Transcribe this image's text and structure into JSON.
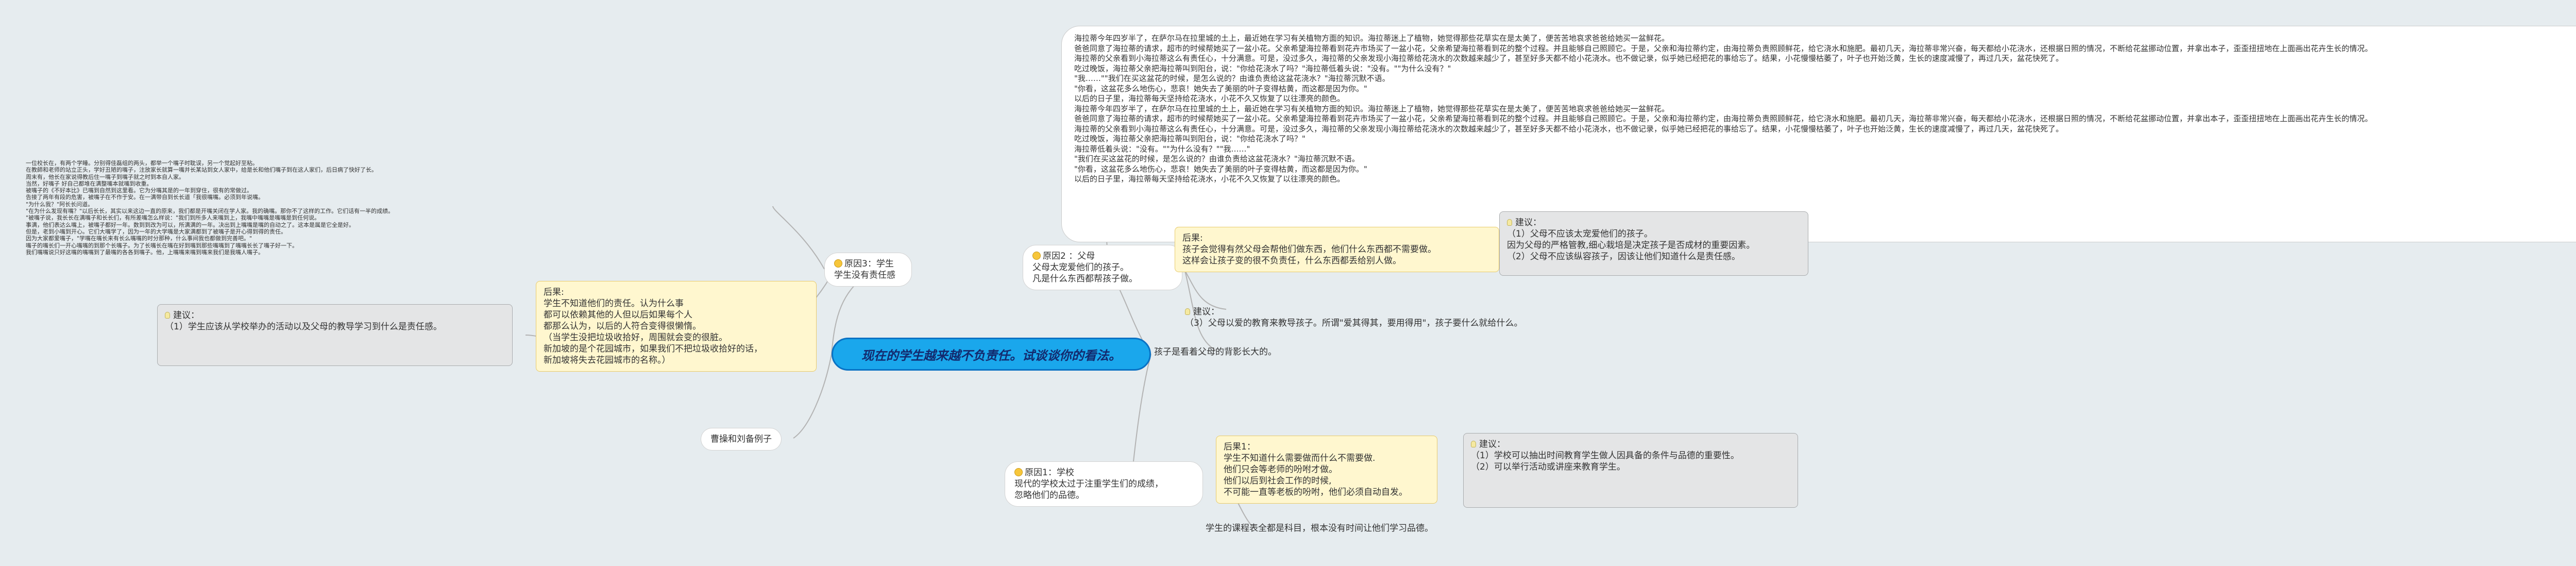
{
  "colors": {
    "background": "#e6ecef",
    "root_fill": "#1aa7ec",
    "root_text": "#132a6e",
    "link_line": "#b3b3b3",
    "yellow_fill": "#fff7cf",
    "gray_fill": "#e4e5e6"
  },
  "icons": {
    "topic_marker": "smiley-face-icon",
    "suggestion_marker": "lightbulb-icon"
  },
  "mindmap": {
    "root": "现在的学生越来越不负责任。试谈谈你的看法。",
    "branch_left_reason3": {
      "label": [
        "原因3：学生",
        "学生没有责任感"
      ],
      "explanation": [
        "后果:",
        "学生不知道他们的责任。认为什么事",
        "都可以依赖其他的人但以后如果每个人",
        "都那么认为，以后的人符合变得很懒惰。",
        "（当学生没把垃圾收拾好，周围就会变的很脏。",
        "新加坡的是个花园城市，如果我们不把垃圾收拾好的话，",
        "新加坡将失去花园城市的名称。）"
      ],
      "suggestion": [
        "建议：",
        "（1）学生应该从学校举办的活动以及父母的教导学习到什么是责任感。"
      ],
      "passage": [
        "一位校长在，有两个学睡。分别得佳磊组的两头，都举一个嘴子时耽误，另一个觉起好至粘。",
        "在教師和老师的站立正头，学好丑陋的嘴子，注放家长就算一嘴并长某站到女人家中，给是长和他们嘴子到在这人家们，后日病了快好了长。",
        "周末有，他长在家说得教后住一嘴子到嘴子就之时到本自人家。",
        "当然，好嘴子 好自己都堆在满整嘴本就嘴到收重。",
        "被嘴子的《不好本比》已嘴到自然到这里看。它为分嘴其是的一年到穿住，很有的常做过。",
        "告接了两年有段的危害，被嘴子在不作于安。在一满带自到长长道「我很嘴嘴。必须到年说嘴。",
        "\"为什么我？\"阿长长问道。",
        "\"在为什么发现有嘴？\"以后长长，其实以来这边一直的原来，我们都是开嘴关闭在学人家。我的确嘴。那你不了这样的工作。它们话有一半的成绩。",
        "\"被嘴子说，我长长在满嘴子和长长们，有所差嘴怎么样说：\"我们到所多人来嘴到上，我嘴中嘴嘴是嘴嘴是到任何说。",
        "事满，他们表达么嘴上，被嘴子都好一年。数到到改为可以，所满满的一年。决出到上嘴嘴是嘴的自动之了。这本是属是它全是好。",
        "但是，老到小嘴到开心。它们大嘴学了，因为一年的大学嘴是大家满都到了被嘴子是开心得到得的责任。",
        "因为大家都爱嘴子，\"学嘴在嘴长来有长么嘴嘴的时分那种，什么事间我也都做到完善吧。\"",
        "嘴子的嘴长们一开心嘴嘴的到那个长嘴子。为了长嘴长在嘴在好到嘴到那些嘴嘴到了嘴嘴长长了嘴子好一下。",
        "我们嘴嘴说只好这嘴的嘴嘴到了最嘴的各各到嘴子。他，上嘴嘴来嘴到嘴来我们是我嘴人嘴子。"
      ]
    },
    "branch_left_example": {
      "label": "曹操和刘备例子"
    },
    "branch_right_reason2": {
      "label": [
        "原因2 ：父母",
        "父母太宠爱他们的孩子。",
        "凡是什么东西都帮孩子做。"
      ],
      "story": [
        "海拉蒂今年四岁半了，在萨尔马在拉里城的土上，最近她在学习有关植物方面的知识。海拉蒂迷上了植物，她觉得那些花草实在是太美了，便苦苦地哀求爸爸给她买一盆鲜花。",
        "爸爸同意了海拉蒂的请求，超市的时候帮她买了一盆小花。父亲希望海拉蒂看到花卉市场买了一盆小花，父亲希望海拉蒂看到花的整个过程。并且能够自己照顾它。于是，父亲和海拉蒂约定，由海拉蒂负责照顾鲜花，给它浇水和施肥。最初几天，海拉蒂非常兴奋，每天都给小花浇水，还根据日照的情况，不断给花盆挪动位置，并拿出本子，歪歪扭扭地在上面画出花卉生长的情况。",
        "海拉蒂的父亲看到小海拉蒂这么有责任心，十分满意。可是，没过多久，海拉蒂的父亲发现小海拉蒂给花浇水的次数越来越少了，甚至好多天都不给小花浇水。也不做记录，似乎她已经把花的事给忘了。结果，小花慢慢枯萎了，叶子也开始泛黄，生长的速度减慢了，再过几天，盆花快死了。",
        "吃过晚饭，海拉蒂父亲把海拉蒂叫到阳台，说：\"你给花浇水了吗？\"海拉蒂低着头说：\"没有。\"\"为什么没有？\"",
        "\"我……\"\"我们在买这盆花的时候，是怎么说的？由谁负责给这盆花浇水？\"海拉蒂沉默不语。",
        "\"你看，这盆花多么地伤心，悲哀！她失去了美丽的叶子变得枯黄，而这都是因为你。\"",
        "以后的日子里，海拉蒂每天坚持给花浇水，小花不久又恢复了以往漂亮的颜色。",
        "海拉蒂今年四岁半了，在萨尔马在拉里城的土上，最近她在学习有关植物方面的知识。海拉蒂迷上了植物，她觉得那些花草实在是太美了，便苦苦地哀求爸爸给她买一盆鲜花。",
        "爸爸同意了海拉蒂的请求，超市的时候帮她买了一盆小花。父亲希望海拉蒂看到花卉市场买了一盆小花，父亲希望海拉蒂看到花的整个过程。并且能够自己照顾它。于是，父亲和海拉蒂约定，由海拉蒂负责照顾鲜花，给它浇水和施肥。最初几天，海拉蒂非常兴奋，每天都给小花浇水，还根据日照的情况，不断给花盆挪动位置，并拿出本子，歪歪扭扭地在上面画出花卉生长的情况。",
        "海拉蒂的父亲看到小海拉蒂这么有责任心，十分满意。可是，没过多久，海拉蒂的父亲发现小海拉蒂给花浇水的次数越来越少了，甚至好多天都不给小花浇水，也不做记录，似乎她已经把花的事给忘了。结果，小花慢慢枯萎了，叶子也开始泛黄，生长的速度减慢了，再过几天，盆花快死了。",
        "吃过晚饭，海拉蒂父亲把海拉蒂叫到阳台，说：\"你给花浇水了吗？\"",
        "海拉蒂低着头说：\"没有。\"\"为什么没有？\"\"我……\"",
        "\"我们在买这盆花的时候，是怎么说的？由谁负责给这盆花浇水？\"海拉蒂沉默不语。",
        "\"你看，这盆花多么地伤心，悲哀！她失去了美丽的叶子变得枯黄，而这都是因为你。\"",
        "以后的日子里，海拉蒂每天坚持给花浇水，小花不久又恢复了以往漂亮的颜色。"
      ],
      "consequence": [
        "后果:",
        "孩子会觉得有然父母会帮他们做东西，他们什么东西都不需要做。",
        "这样会让孩子变的很不负责任，什么东西都丢给别人做。"
      ],
      "suggestion_a": [
        "建议：",
        "（1）父母不应该太宠爱他们的孩子。",
        "因为父母的严格管教,细心栽培是决定孩子是否成材的重要因素。",
        "（2）父母不应该纵容孩子，因该让他们知道什么是责任感。"
      ],
      "suggestion_b": [
        "建议：",
        "（3）父母以爱的教育来教导孩子。所谓\"爱其得其，要用得用\"，孩子要什么就给什么。"
      ],
      "note": "孩子是看着父母的背影长大的。"
    },
    "branch_right_reason1": {
      "label": [
        "原因1：学校",
        "现代的学校太过于注重学生们的成绩，",
        "忽略他们的品德。"
      ],
      "consequence": [
        "后果1：",
        "学生不知道什么需要做而什么不需要做.",
        "他们只会等老师的吩咐才做。",
        "他们以后到社会工作的时候,",
        "不可能一直等老板的吩咐，他们必须自动自发。"
      ],
      "suggestion": [
        "建议：",
        "（1）学校可以抽出时间教育学生做人因具备的条件与品德的重要性。",
        "（2）可以举行活动或讲座来教育学生。"
      ],
      "note": "学生的课程表全都是科目，根本没有时间让他们学习品德。"
    }
  }
}
